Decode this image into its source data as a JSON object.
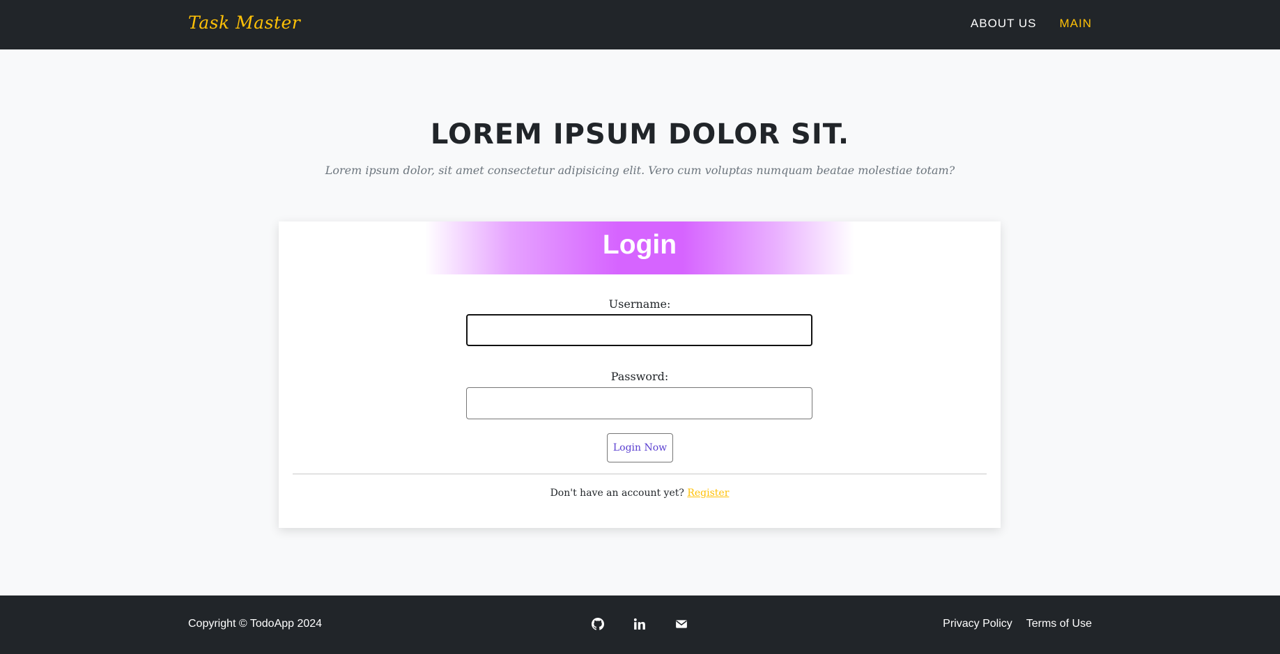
{
  "navbar": {
    "brand": "Task Master",
    "links": [
      {
        "label": "ABOUT US",
        "active": false
      },
      {
        "label": "MAIN",
        "active": true
      }
    ]
  },
  "hero": {
    "title": "LOREM IPSUM DOLOR SIT.",
    "subtitle": "Lorem ipsum dolor, sit amet consectetur adipisicing elit. Vero cum voluptas numquam beatae molestiae totam?"
  },
  "login": {
    "title": "Login",
    "username_label": "Username:",
    "username_value": "",
    "password_label": "Password:",
    "password_value": "",
    "submit_label": "Login Now",
    "register_prompt": "Don't have an account yet?",
    "register_link": "Register"
  },
  "footer": {
    "copyright": "Copyright © TodoApp 2024",
    "social": [
      "github-icon",
      "linkedin-icon",
      "envelope-icon"
    ],
    "links": [
      "Privacy Policy",
      "Terms of Use"
    ]
  },
  "colors": {
    "dark": "#212529",
    "accent": "#ffc107",
    "header_gradient": "#d664ff",
    "button_text": "#5a3fd0"
  }
}
